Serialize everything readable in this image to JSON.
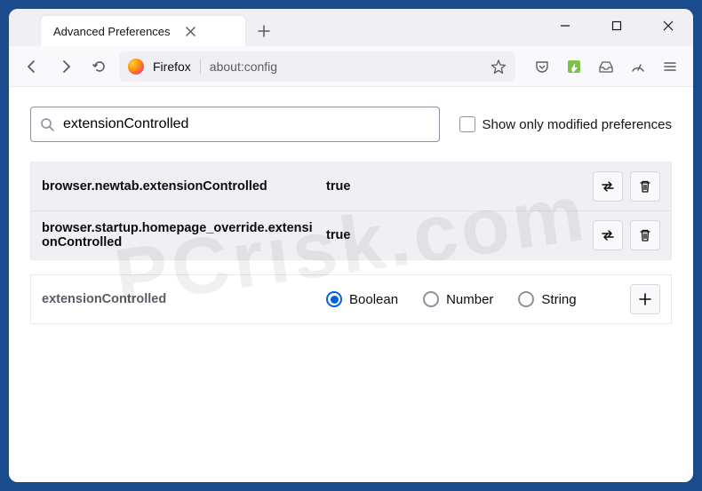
{
  "window": {
    "tab_title": "Advanced Preferences"
  },
  "toolbar": {
    "brand": "Firefox",
    "url": "about:config"
  },
  "search": {
    "value": "extensionControlled",
    "modified_only_label": "Show only modified preferences"
  },
  "prefs": [
    {
      "name": "browser.newtab.extensionControlled",
      "value": "true"
    },
    {
      "name": "browser.startup.homepage_override.extensionControlled",
      "value": "true"
    }
  ],
  "newpref": {
    "name": "extensionControlled",
    "types": {
      "boolean": "Boolean",
      "number": "Number",
      "string": "String"
    },
    "selected": "boolean"
  },
  "watermark": "PCrisk.com"
}
